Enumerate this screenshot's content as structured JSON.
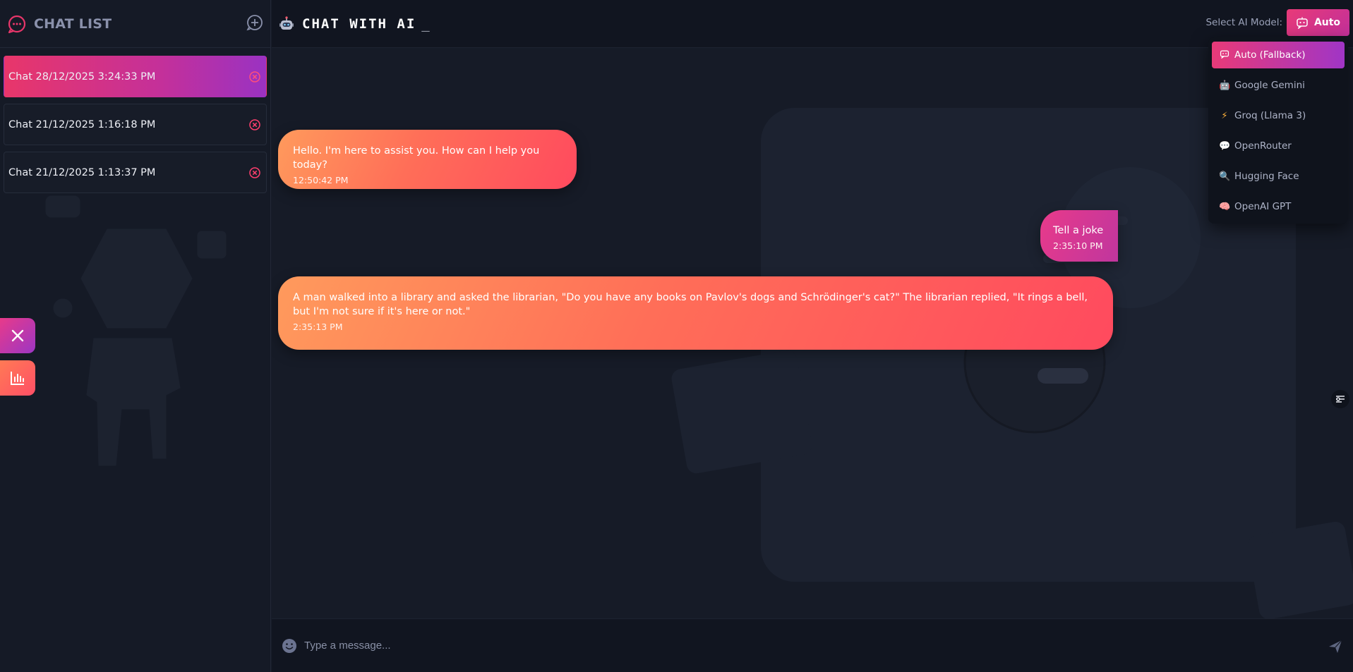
{
  "sidebar": {
    "title": "CHAT LIST",
    "chats": [
      {
        "label": "Chat 28/12/2025 3:24:33 PM"
      },
      {
        "label": "Chat 21/12/2025 1:16:18 PM"
      },
      {
        "label": "Chat 21/12/2025 1:13:37 PM"
      }
    ]
  },
  "header": {
    "title": "CHAT WITH AI",
    "cursor": "_",
    "model_label": "Select AI Model:",
    "model_button": "Auto"
  },
  "models": [
    {
      "icon": "bot-icon",
      "label": "Auto (Fallback)"
    },
    {
      "icon": "robot-emoji",
      "label": "Google Gemini"
    },
    {
      "icon": "lightning-emoji",
      "label": "Groq (Llama 3)"
    },
    {
      "icon": "speech-bubble-emoji",
      "label": "OpenRouter"
    },
    {
      "icon": "magnifier-emoji",
      "label": "Hugging Face"
    },
    {
      "icon": "brain-emoji",
      "label": "OpenAI GPT"
    }
  ],
  "messages": [
    {
      "text": "Hello. I'm here to assist you. How can I help you today?",
      "time": "12:50:42 PM"
    },
    {
      "text": "Tell a joke",
      "time": "2:35:10 PM"
    },
    {
      "text": "A man walked into a library and asked the librarian, \"Do you have any books on Pavlov's dogs and Schrödinger's cat?\" The librarian replied, \"It rings a bell, but I'm not sure if it's here or not.\"",
      "time": "2:35:13 PM"
    }
  ],
  "input": {
    "placeholder": "Type a message..."
  },
  "colors": {
    "accent_pink": "#e83a78",
    "accent_purple": "#a035c6",
    "bubble_orange": "#ff7a58"
  }
}
